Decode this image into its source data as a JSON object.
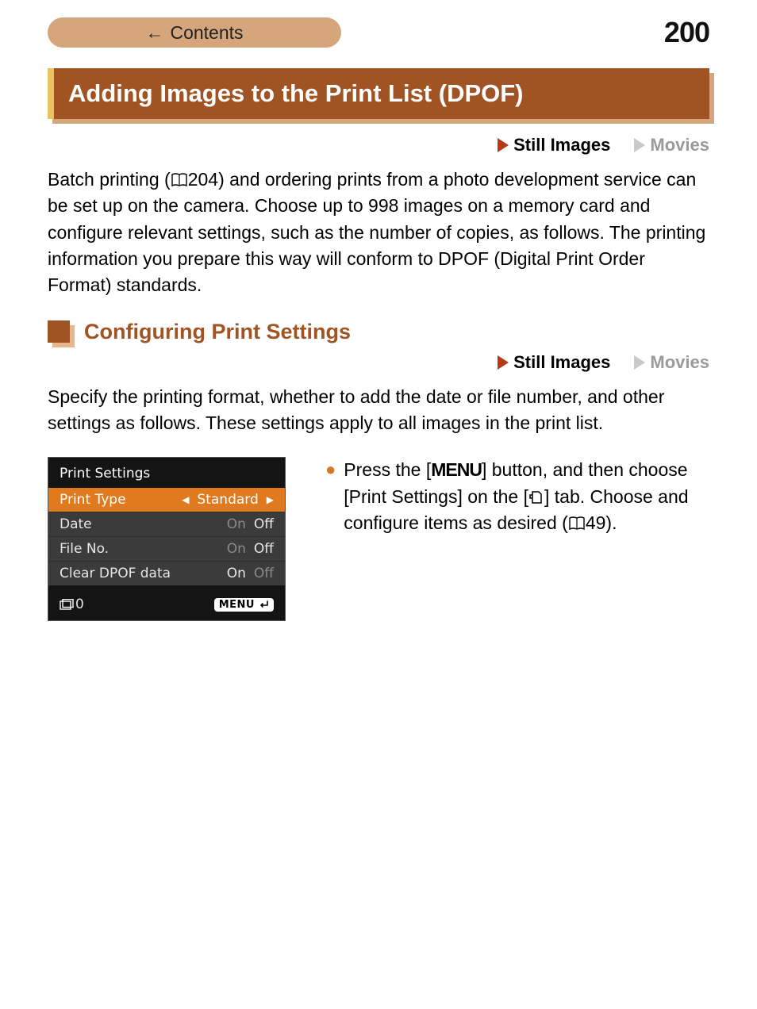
{
  "header": {
    "contents_label": "Contents",
    "page_number": "200"
  },
  "h1": "Adding Images to the Print List (DPOF)",
  "media_tags": {
    "still": "Still Images",
    "movies": "Movies"
  },
  "intro": {
    "p1a": "Batch printing (",
    "p1_ref": "204",
    "p1b": ") and ordering prints from a photo development service can be set up on the camera. Choose up to 998 images on a memory card and configure relevant settings, such as the number of copies, as follows. The printing information you prepare this way will conform to DPOF (Digital Print Order Format) standards."
  },
  "h2": "Configuring Print Settings",
  "sub_intro": "Specify the printing format, whether to add the date or file number, and other settings as follows. These settings apply to all images in the print list.",
  "lcd": {
    "title": "Print Settings",
    "rows": [
      {
        "label": "Print Type",
        "on": "",
        "off": "Standard",
        "selected": true,
        "arrows": true
      },
      {
        "label": "Date",
        "on": "On",
        "off": "Off",
        "selected": false,
        "active": "off"
      },
      {
        "label": "File No.",
        "on": "On",
        "off": "Off",
        "selected": false,
        "active": "off"
      },
      {
        "label": "Clear DPOF data",
        "on": "On",
        "off": "Off",
        "selected": false,
        "active": "on"
      }
    ],
    "footer_count": "0",
    "footer_menu": "MENU"
  },
  "instruction": {
    "t1": "Press the [",
    "menu_word": "MENU",
    "t2": "] button, and then choose [Print Settings] on the [",
    "t3": "] tab. Choose and configure items as desired (",
    "ref": "49",
    "t4": ")."
  }
}
